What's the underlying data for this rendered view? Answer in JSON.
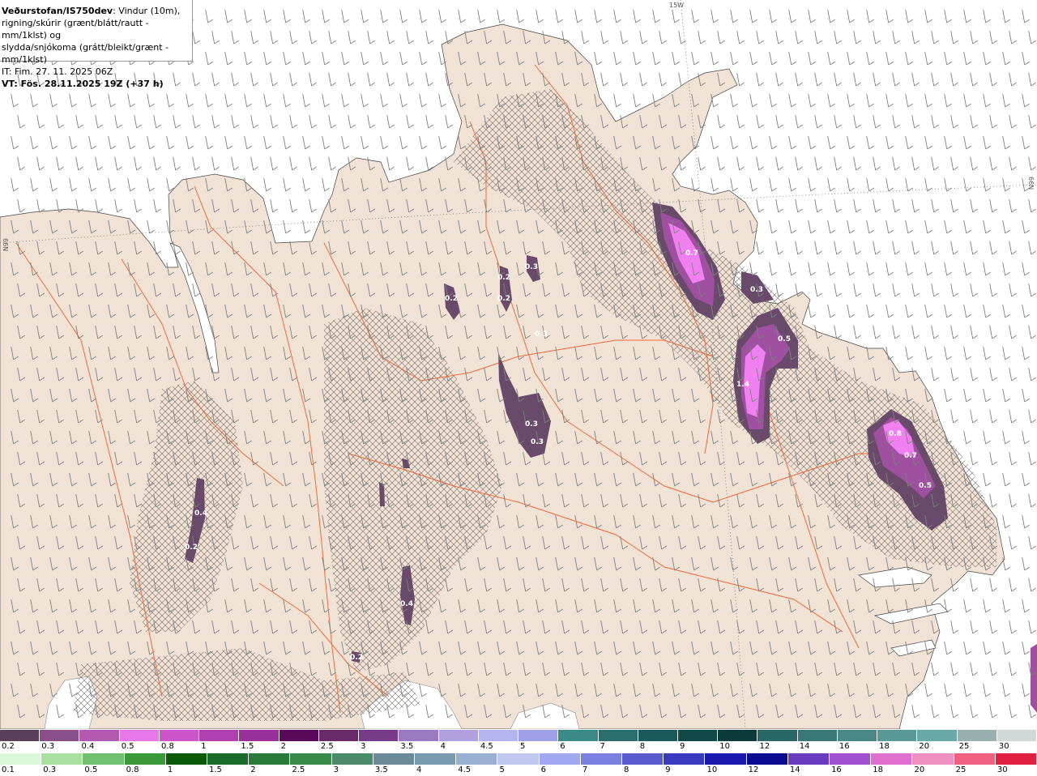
{
  "header": {
    "title_strong": "Veðurstofan/IS750dev",
    "title_rest": ": Vindur (10m),",
    "line2": "rigning/skúrir (grænt/blátt/rautt - mm/1klst) og",
    "line3": "slydda/snjókoma (grátt/bleikt/grænt - mm/1klst)",
    "it_line": "IT: Fim. 27. 11. 2025 06Z",
    "vt_line": "VT: Fös. 28.11.2025 19Z (+37 h)"
  },
  "grid_labels": {
    "top": "15W",
    "right": "66N",
    "left": "66N"
  },
  "value_labels": [
    "0.7",
    "0.3",
    "0.5",
    "1.4",
    "0.8",
    "0.7",
    "0.5",
    "0.3",
    "0.2",
    "0.2",
    "0.2",
    "0.3",
    "0.3",
    "0.3",
    "0.4",
    "0.2",
    "0.4",
    "0.2"
  ],
  "legend_snow": {
    "labels": [
      "0.2",
      "0.3",
      "0.4",
      "0.5",
      "0.8",
      "1",
      "1.5",
      "2",
      "2.5",
      "3",
      "3.5",
      "4",
      "4.5",
      "5",
      "6",
      "7",
      "8",
      "9",
      "10",
      "12",
      "14",
      "16",
      "18",
      "20",
      "25",
      "30"
    ],
    "colors": [
      "#5a3e5a",
      "#8a4e8a",
      "#b25ab2",
      "#e878e8",
      "#cc55cc",
      "#b040b0",
      "#9a309a",
      "#5a0a5a",
      "#6a2a6a",
      "#7a3a8a",
      "#9a7ac0",
      "#b0a0e0",
      "#b4b4f0",
      "#a0a0e8",
      "#3a8a8a",
      "#2a6e6e",
      "#1a5a5a",
      "#124a4a",
      "#0a3a3a",
      "#2a6868",
      "#3a7878",
      "#4a8888",
      "#5a9898",
      "#6aa8a8",
      "#9ab0b0",
      "#d0d8d8"
    ]
  },
  "legend_rain": {
    "labels": [
      "0.1",
      "0.3",
      "0.5",
      "0.8",
      "1",
      "1.5",
      "2",
      "2.5",
      "3",
      "3.5",
      "4",
      "4.5",
      "5",
      "6",
      "7",
      "8",
      "9",
      "10",
      "12",
      "14",
      "16",
      "18",
      "20",
      "25",
      "30"
    ],
    "colors": [
      "#d8f8d8",
      "#a8e0a0",
      "#70c070",
      "#3a9a3a",
      "#0a5a0a",
      "#1a6a2a",
      "#2a7a3a",
      "#3a8a4a",
      "#4a8a6a",
      "#6a8a9a",
      "#7a9ab0",
      "#9ab0d0",
      "#c0c8f0",
      "#a0a8f0",
      "#7a80e0",
      "#5a5ad0",
      "#3a3ac0",
      "#1a1ab0",
      "#0a0a90",
      "#6a3ac0",
      "#a050d0",
      "#e070d0",
      "#f090c0",
      "#f06080",
      "#e02040"
    ]
  },
  "colors": {
    "land": "#f0e2d4",
    "sea": "#ffffff",
    "roads": "#f06a3a",
    "snow_light": "#6a4a6a",
    "snow_mid": "#a050a0",
    "snow_heavy": "#f080f0",
    "wind_barb": "#808080"
  }
}
